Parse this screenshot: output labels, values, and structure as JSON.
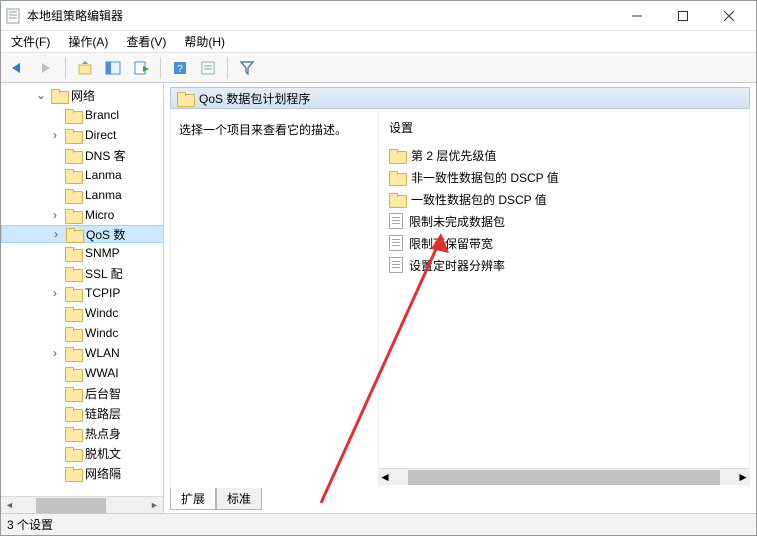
{
  "window": {
    "title": "本地组策略编辑器"
  },
  "menu": {
    "file": "文件(F)",
    "action": "操作(A)",
    "view": "查看(V)",
    "help": "帮助(H)"
  },
  "tree": {
    "root": "网络",
    "items": [
      {
        "label": "Brancl",
        "expandable": false
      },
      {
        "label": "Direct",
        "expandable": true
      },
      {
        "label": "DNS 客",
        "expandable": false
      },
      {
        "label": "Lanma",
        "expandable": false
      },
      {
        "label": "Lanma",
        "expandable": false
      },
      {
        "label": "Micro",
        "expandable": true
      },
      {
        "label": "QoS 数",
        "expandable": true,
        "selected": true
      },
      {
        "label": "SNMP",
        "expandable": false
      },
      {
        "label": "SSL 配",
        "expandable": false
      },
      {
        "label": "TCPIP",
        "expandable": true
      },
      {
        "label": "Windc",
        "expandable": false
      },
      {
        "label": "Windc",
        "expandable": false
      },
      {
        "label": "WLAN",
        "expandable": true
      },
      {
        "label": "WWAI",
        "expandable": false
      },
      {
        "label": "后台智",
        "expandable": false
      },
      {
        "label": "链路层",
        "expandable": false
      },
      {
        "label": "热点身",
        "expandable": false
      },
      {
        "label": "脱机文",
        "expandable": false
      },
      {
        "label": "网络隔",
        "expandable": false
      }
    ]
  },
  "content": {
    "header": "QoS 数据包计划程序",
    "desc_prompt": "选择一个项目来查看它的描述。",
    "col_setting": "设置",
    "items": [
      {
        "type": "folder",
        "label": "第 2 层优先级值"
      },
      {
        "type": "folder",
        "label": "非一致性数据包的 DSCP 值"
      },
      {
        "type": "folder",
        "label": "一致性数据包的 DSCP 值"
      },
      {
        "type": "setting",
        "label": "限制未完成数据包"
      },
      {
        "type": "setting",
        "label": "限制可保留带宽"
      },
      {
        "type": "setting",
        "label": "设置定时器分辨率"
      }
    ]
  },
  "tabs": {
    "extended": "扩展",
    "standard": "标准"
  },
  "status": {
    "text": "3 个设置"
  }
}
